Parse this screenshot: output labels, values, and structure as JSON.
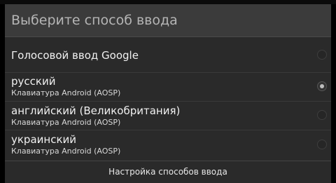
{
  "dialog": {
    "title": "Выберите способ ввода",
    "items": [
      {
        "name": "Голосовой ввод Google",
        "subtitle": "",
        "selected": false
      },
      {
        "name": "русский",
        "subtitle": "Клавиатура Android (AOSP)",
        "selected": true
      },
      {
        "name": "английский (Великобритания)",
        "subtitle": "Клавиатура Android (AOSP)",
        "selected": false
      },
      {
        "name": "украинский",
        "subtitle": "Клавиатура Android (AOSP)",
        "selected": false
      }
    ],
    "footer_button": "Настройка способов ввода"
  },
  "colors": {
    "title_bar": "#3b3b3b",
    "dialog_bg": "#2a2a2a",
    "radio_selected": "#bdbdbd"
  },
  "icons": {
    "radio": "radio-button-icon"
  }
}
